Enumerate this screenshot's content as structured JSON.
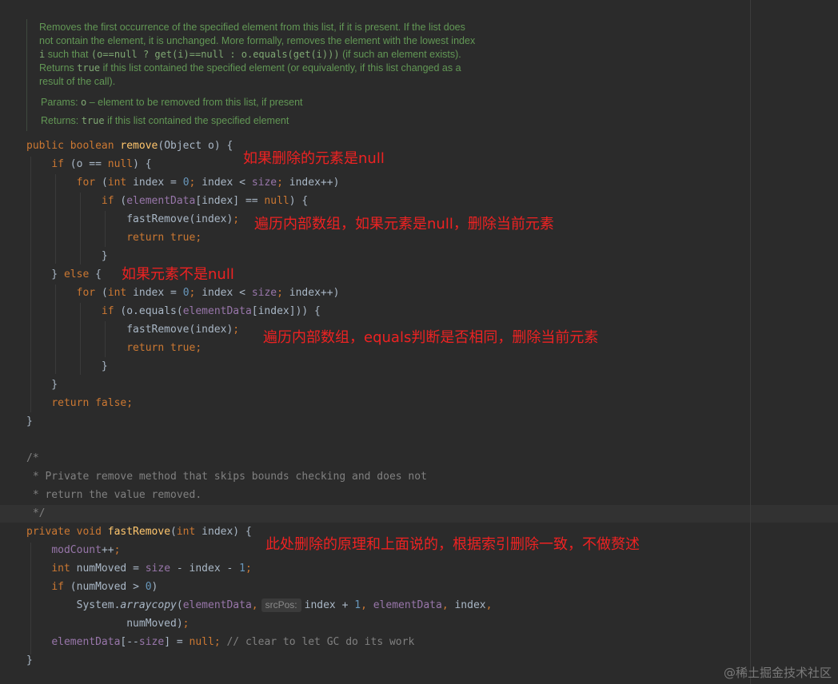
{
  "doc": {
    "l1": "Removes the first occurrence of the specified element from this list, if it is present. If the list does",
    "l2": "not contain the element, it is unchanged. More formally, removes the element with the lowest index",
    "l3a": "i",
    "l3b": " such that ",
    "l3c": "(o==null ? get(i)==null : o.equals(get(i)))",
    "l3d": " (if such an element exists).",
    "l4a": "Returns ",
    "l4b": "true",
    "l4c": " if this list contained the specified element (or equivalently, if this list changed as a",
    "l5": "result of the call).",
    "params_label": "Params:",
    "params_code": "o",
    "params_text": " – element to be removed from this list, if present",
    "returns_label": "Returns:",
    "returns_code": "true",
    "returns_text": " if this list contained the specified element"
  },
  "annotations": {
    "a1": "如果删除的元素是null",
    "a2": "遍历内部数组，如果元素是null，删除当前元素",
    "a3": "如果元素不是null",
    "a4": "遍历内部数组，equals判断是否相同，删除当前元素",
    "a5": "此处删除的原理和上面说的，根据索引删除一致，不做赘述"
  },
  "hint": {
    "srcpos": "srcPos:"
  },
  "comment": {
    "c1": "/*",
    "c2": " * Private remove method that skips bounds checking and does not",
    "c3": " * return the value removed.",
    "c4": " */",
    "c5": "// clear to let GC do its work"
  },
  "watermark": "@稀土掘金技术社区"
}
